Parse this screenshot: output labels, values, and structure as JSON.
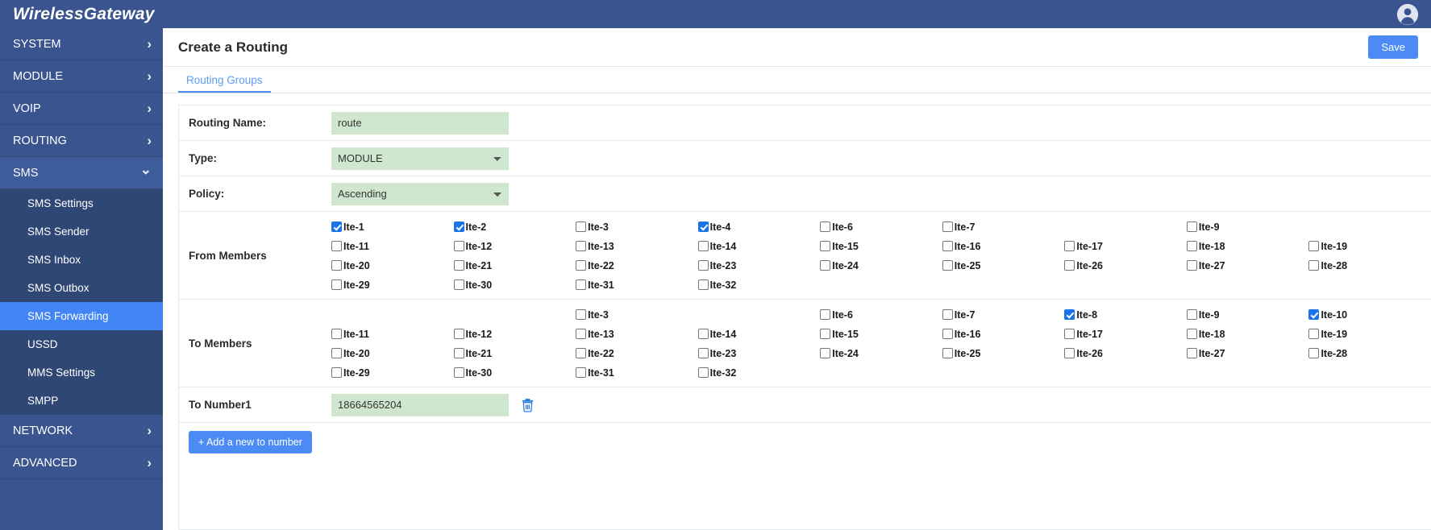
{
  "app": {
    "brand": "WirelessGateway",
    "avatar_icon": "user-circle-icon"
  },
  "sidebar": {
    "items": [
      {
        "label": "SYSTEM",
        "type": "top",
        "icon": "chevron-right-icon",
        "expanded": false
      },
      {
        "label": "MODULE",
        "type": "top",
        "icon": "chevron-right-icon",
        "expanded": false
      },
      {
        "label": "VOIP",
        "type": "top",
        "icon": "chevron-right-icon",
        "expanded": false
      },
      {
        "label": "ROUTING",
        "type": "top",
        "icon": "chevron-right-icon",
        "expanded": false
      },
      {
        "label": "SMS",
        "type": "top",
        "icon": "chevron-down-icon",
        "expanded": true
      },
      {
        "label": "SMS Settings",
        "type": "sub",
        "active": false
      },
      {
        "label": "SMS Sender",
        "type": "sub",
        "active": false
      },
      {
        "label": "SMS Inbox",
        "type": "sub",
        "active": false
      },
      {
        "label": "SMS Outbox",
        "type": "sub",
        "active": false
      },
      {
        "label": "SMS Forwarding",
        "type": "sub",
        "active": true
      },
      {
        "label": "USSD",
        "type": "sub",
        "active": false
      },
      {
        "label": "MMS Settings",
        "type": "sub",
        "active": false
      },
      {
        "label": "SMPP",
        "type": "sub",
        "active": false
      },
      {
        "label": "NETWORK",
        "type": "top",
        "icon": "chevron-right-icon",
        "expanded": false
      },
      {
        "label": "ADVANCED",
        "type": "top",
        "icon": "chevron-right-icon",
        "expanded": false
      }
    ]
  },
  "header": {
    "title": "Create a Routing",
    "save_label": "Save"
  },
  "tabs": [
    {
      "label": "Routing Groups",
      "active": true
    }
  ],
  "form": {
    "routing_name": {
      "label": "Routing Name:",
      "value": "route",
      "placeholder": ""
    },
    "type": {
      "label": "Type:",
      "value": "MODULE",
      "options": [
        "MODULE"
      ]
    },
    "policy": {
      "label": "Policy:",
      "value": "Ascending",
      "options": [
        "Ascending"
      ]
    },
    "from_members": {
      "label": "From Members"
    },
    "to_members": {
      "label": "To Members"
    },
    "to_number1": {
      "label": "To Number1",
      "value": "18664565204",
      "delete_icon": "trash-icon"
    },
    "add_button": {
      "label": "+ Add a new to number"
    }
  },
  "from_members_grid": [
    [
      {
        "label": "Ite-1",
        "checked": true
      },
      {
        "label": "Ite-2",
        "checked": true
      },
      {
        "label": "Ite-3",
        "checked": false
      },
      {
        "label": "Ite-4",
        "checked": true
      },
      {
        "label": "Ite-6",
        "checked": false
      },
      {
        "label": "Ite-7",
        "checked": false
      },
      null,
      {
        "label": "Ite-9",
        "checked": false
      },
      null
    ],
    [
      {
        "label": "Ite-11",
        "checked": false
      },
      {
        "label": "Ite-12",
        "checked": false
      },
      {
        "label": "Ite-13",
        "checked": false
      },
      {
        "label": "Ite-14",
        "checked": false
      },
      {
        "label": "Ite-15",
        "checked": false
      },
      {
        "label": "Ite-16",
        "checked": false
      },
      {
        "label": "Ite-17",
        "checked": false
      },
      {
        "label": "Ite-18",
        "checked": false
      },
      {
        "label": "Ite-19",
        "checked": false
      }
    ],
    [
      {
        "label": "Ite-20",
        "checked": false
      },
      {
        "label": "Ite-21",
        "checked": false
      },
      {
        "label": "Ite-22",
        "checked": false
      },
      {
        "label": "Ite-23",
        "checked": false
      },
      {
        "label": "Ite-24",
        "checked": false
      },
      {
        "label": "Ite-25",
        "checked": false
      },
      {
        "label": "Ite-26",
        "checked": false
      },
      {
        "label": "Ite-27",
        "checked": false
      },
      {
        "label": "Ite-28",
        "checked": false
      }
    ],
    [
      {
        "label": "Ite-29",
        "checked": false
      },
      {
        "label": "Ite-30",
        "checked": false
      },
      {
        "label": "Ite-31",
        "checked": false
      },
      {
        "label": "Ite-32",
        "checked": false
      },
      null,
      null,
      null,
      null,
      null
    ]
  ],
  "to_members_grid": [
    [
      null,
      null,
      {
        "label": "Ite-3",
        "checked": false
      },
      null,
      {
        "label": "Ite-6",
        "checked": false
      },
      {
        "label": "Ite-7",
        "checked": false
      },
      {
        "label": "Ite-8",
        "checked": true
      },
      {
        "label": "Ite-9",
        "checked": false
      },
      {
        "label": "Ite-10",
        "checked": true
      }
    ],
    [
      {
        "label": "Ite-11",
        "checked": false
      },
      {
        "label": "Ite-12",
        "checked": false
      },
      {
        "label": "Ite-13",
        "checked": false
      },
      {
        "label": "Ite-14",
        "checked": false
      },
      {
        "label": "Ite-15",
        "checked": false
      },
      {
        "label": "Ite-16",
        "checked": false
      },
      {
        "label": "Ite-17",
        "checked": false
      },
      {
        "label": "Ite-18",
        "checked": false
      },
      {
        "label": "Ite-19",
        "checked": false
      }
    ],
    [
      {
        "label": "Ite-20",
        "checked": false
      },
      {
        "label": "Ite-21",
        "checked": false
      },
      {
        "label": "Ite-22",
        "checked": false
      },
      {
        "label": "Ite-23",
        "checked": false
      },
      {
        "label": "Ite-24",
        "checked": false
      },
      {
        "label": "Ite-25",
        "checked": false
      },
      {
        "label": "Ite-26",
        "checked": false
      },
      {
        "label": "Ite-27",
        "checked": false
      },
      {
        "label": "Ite-28",
        "checked": false
      }
    ],
    [
      {
        "label": "Ite-29",
        "checked": false
      },
      {
        "label": "Ite-30",
        "checked": false
      },
      {
        "label": "Ite-31",
        "checked": false
      },
      {
        "label": "Ite-32",
        "checked": false
      },
      null,
      null,
      null,
      null,
      null
    ]
  ],
  "colors": {
    "brand_blue": "#39548f",
    "accent_blue": "#4c8bf5",
    "active_nav": "#4285f4",
    "field_green": "#cfe7cf",
    "checkbox_on": "#1a73e8"
  }
}
